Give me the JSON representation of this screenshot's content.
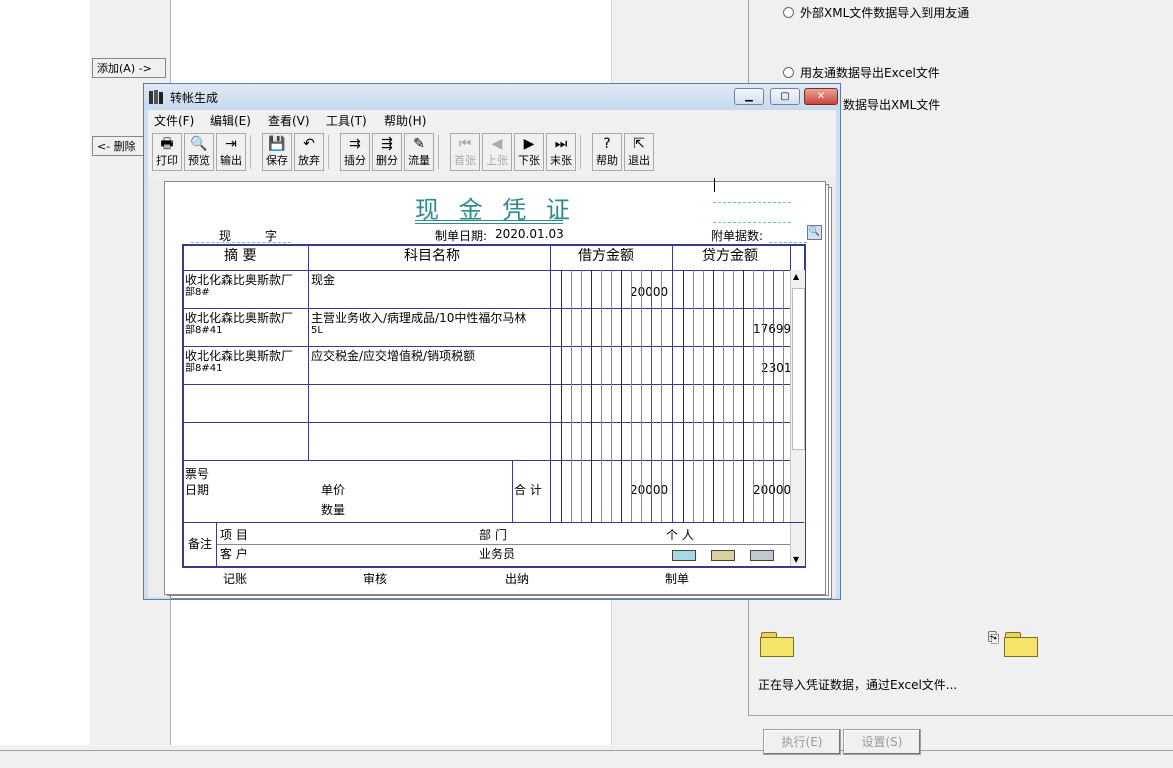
{
  "left_panel": {
    "add_button": "添加(A) ->",
    "delete_button": "<- 删除"
  },
  "right_panel": {
    "radio1": "外部XML文件数据导入到用友通",
    "radio2": "用友通数据导出Excel文件",
    "radio3_partial": "数据导出XML文件",
    "status_text": "正在导入凭证数据，通过Excel文件...",
    "execute_button": "执行(E)",
    "settings_button": "设置(S)"
  },
  "window": {
    "title": "转帐生成",
    "menu": [
      "文件(F)",
      "编辑(E)",
      "查看(V)",
      "工具(T)",
      "帮助(H)"
    ],
    "toolbar": [
      {
        "label": "打印",
        "icon": "print-icon",
        "glyph": "🖶",
        "enabled": true
      },
      {
        "label": "预览",
        "icon": "preview-icon",
        "glyph": "🔍",
        "enabled": true
      },
      {
        "label": "输出",
        "icon": "export-icon",
        "glyph": "⇥",
        "enabled": true
      },
      {
        "label": "保存",
        "icon": "save-icon",
        "glyph": "💾",
        "enabled": true
      },
      {
        "label": "放弃",
        "icon": "undo-icon",
        "glyph": "↶",
        "enabled": true
      },
      {
        "label": "插分",
        "icon": "insert-row-icon",
        "glyph": "⇉",
        "enabled": true
      },
      {
        "label": "删分",
        "icon": "delete-row-icon",
        "glyph": "⇶",
        "enabled": true
      },
      {
        "label": "流量",
        "icon": "flow-icon",
        "glyph": "✎",
        "enabled": true
      },
      {
        "label": "首张",
        "icon": "first-icon",
        "glyph": "⏮",
        "enabled": false
      },
      {
        "label": "上张",
        "icon": "prev-icon",
        "glyph": "◀",
        "enabled": false
      },
      {
        "label": "下张",
        "icon": "next-icon",
        "glyph": "▶",
        "enabled": true
      },
      {
        "label": "末张",
        "icon": "last-icon",
        "glyph": "⏭",
        "enabled": true
      },
      {
        "label": "帮助",
        "icon": "help-icon",
        "glyph": "?",
        "enabled": true
      },
      {
        "label": "退出",
        "icon": "exit-icon",
        "glyph": "⇱",
        "enabled": true
      }
    ]
  },
  "voucher": {
    "title": "现 金 凭 证",
    "prefix": "现",
    "zi": "字",
    "date_label": "制单日期:",
    "date": "2020.01.03",
    "attachments_label": "附单据数:",
    "headers": {
      "summary": "摘 要",
      "account": "科目名称",
      "debit": "借方金额",
      "credit": "贷方金额"
    },
    "rows": [
      {
        "summary": "收北化森比奥斯款厂",
        "summary2": "部8#",
        "account": "现金",
        "account2": "",
        "debit": "20000",
        "credit": ""
      },
      {
        "summary": "收北化森比奥斯款厂",
        "summary2": "部8#41",
        "account": "主营业务收入/病理成品/10中性福尔马林",
        "account2": "5L",
        "debit": "",
        "credit": "17699"
      },
      {
        "summary": "收北化森比奥斯款厂",
        "summary2": "部8#41",
        "account": "应交税金/应交增值税/销项税额",
        "account2": "",
        "debit": "",
        "credit": "2301"
      }
    ],
    "footer": {
      "ticket_no": "票号",
      "date": "日期",
      "unit_price": "单价",
      "quantity": "数量",
      "total_label": "合 计",
      "total_debit": "20000",
      "total_credit": "20000"
    },
    "remarks": {
      "label": "备注",
      "project": "项  目",
      "customer": "客  户",
      "department": "部  门",
      "salesperson": "业务员",
      "person": "个  人"
    },
    "signatures": [
      "记账",
      "审核",
      "出纳",
      "制单"
    ]
  },
  "colors": {
    "title_teal": "#2e8b8b",
    "table_border": "#3a3a8a",
    "digit_blue": "#1a1acc",
    "digit_red": "#dd2222"
  }
}
